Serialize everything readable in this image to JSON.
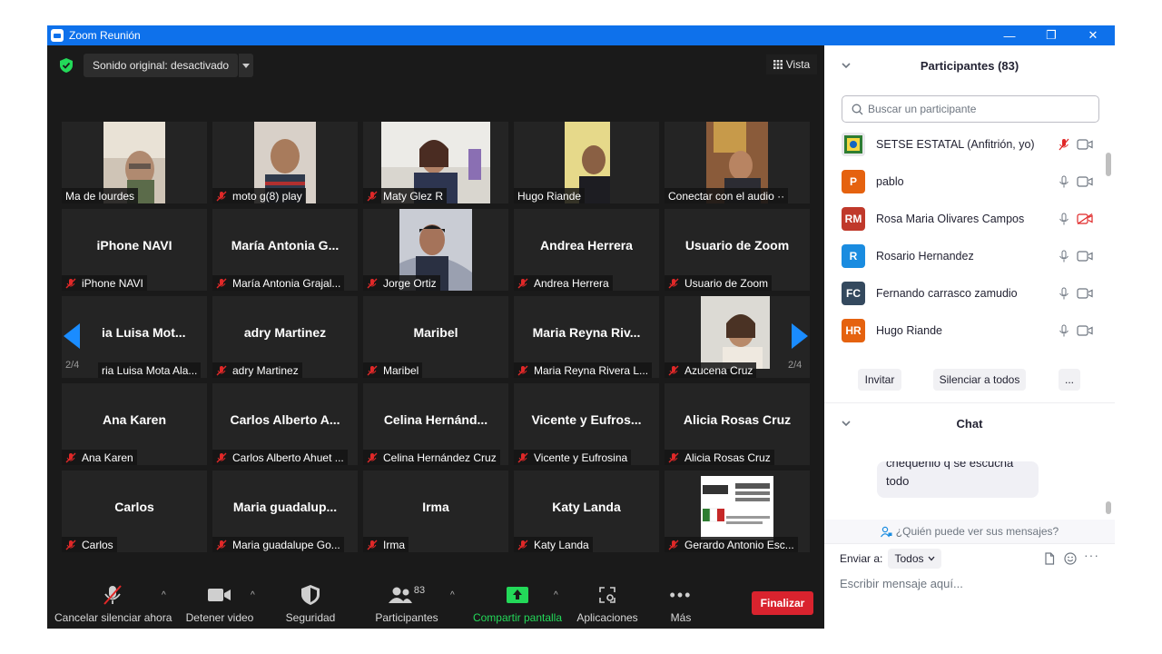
{
  "window": {
    "title": "Zoom Reunión"
  },
  "top_bar": {
    "audio_label": "Sonido original: desactivado",
    "view_label": "Vista"
  },
  "pagination": {
    "left": "2/4",
    "right": "2/4"
  },
  "tiles": [
    {
      "label": "Ma de lourdes",
      "big": "",
      "muted": false,
      "photo": true
    },
    {
      "label": "moto g(8) play",
      "big": "",
      "muted": true,
      "photo": true
    },
    {
      "label": "Maty Glez R",
      "big": "",
      "muted": true,
      "photo": true
    },
    {
      "label": "Hugo Riande",
      "big": "",
      "muted": false,
      "photo": true
    },
    {
      "label": "Conectar con el audio ··",
      "big": "",
      "muted": false,
      "photo": true
    },
    {
      "label": "iPhone NAVI",
      "big": "iPhone NAVI",
      "muted": true,
      "photo": false
    },
    {
      "label": "María Antonia Grajal...",
      "big": "María Antonia G...",
      "muted": true,
      "photo": false
    },
    {
      "label": "Jorge Ortiz",
      "big": "",
      "muted": true,
      "photo": true
    },
    {
      "label": "Andrea Herrera",
      "big": "Andrea Herrera",
      "muted": true,
      "photo": false
    },
    {
      "label": "Usuario de Zoom",
      "big": "Usuario de Zoom",
      "muted": true,
      "photo": false
    },
    {
      "label": "ria Luisa Mota Ala...",
      "big": "ia Luisa Mot...",
      "muted": false,
      "photo": false
    },
    {
      "label": "adry  Martinez",
      "big": "adry  Martinez",
      "muted": true,
      "photo": false
    },
    {
      "label": "Maribel",
      "big": "Maribel",
      "muted": true,
      "photo": false
    },
    {
      "label": "Maria Reyna Rivera L...",
      "big": "Maria Reyna Riv...",
      "muted": true,
      "photo": false
    },
    {
      "label": "Azucena Cruz",
      "big": "",
      "muted": true,
      "photo": true
    },
    {
      "label": "Ana Karen",
      "big": "Ana Karen",
      "muted": true,
      "photo": false
    },
    {
      "label": "Carlos Alberto Ahuet ...",
      "big": "Carlos Alberto A...",
      "muted": true,
      "photo": false
    },
    {
      "label": "Celina Hernández Cruz",
      "big": "Celina  Hernánd...",
      "muted": true,
      "photo": false
    },
    {
      "label": "Vicente y Eufrosina",
      "big": "Vicente y Eufros...",
      "muted": true,
      "photo": false
    },
    {
      "label": "Alicia Rosas Cruz",
      "big": "Alicia Rosas Cruz",
      "muted": true,
      "photo": false
    },
    {
      "label": "Carlos",
      "big": "Carlos",
      "muted": true,
      "photo": false
    },
    {
      "label": "Maria guadalupe Go...",
      "big": "Maria  guadalup...",
      "muted": true,
      "photo": false
    },
    {
      "label": "Irma",
      "big": "Irma",
      "muted": true,
      "photo": false
    },
    {
      "label": "Katy Landa",
      "big": "Katy Landa",
      "muted": true,
      "photo": false
    },
    {
      "label": "Gerardo Antonio Esc...",
      "big": "",
      "muted": true,
      "photo": true
    }
  ],
  "toolbar": {
    "unmute": "Cancelar silenciar ahora",
    "video": "Detener video",
    "security": "Seguridad",
    "participants": "Participantes",
    "participants_count": "83",
    "share": "Compartir pantalla",
    "apps": "Aplicaciones",
    "more": "Más",
    "end": "Finalizar"
  },
  "sidebar": {
    "participants_title": "Participantes (83)",
    "search_placeholder": "Buscar un participante",
    "participants": [
      {
        "initials": "",
        "name": "SETSE ESTATAL (Anfitrión, yo)",
        "color": "#e7e7ea",
        "mic": "muted",
        "cam": "on"
      },
      {
        "initials": "P",
        "name": "pablo",
        "color": "#e5620f",
        "mic": "on",
        "cam": "on"
      },
      {
        "initials": "RM",
        "name": "Rosa Maria Olivares Campos",
        "color": "#c0392b",
        "mic": "on",
        "cam": "off"
      },
      {
        "initials": "R",
        "name": "Rosario Hernandez",
        "color": "#1a8ce0",
        "mic": "on",
        "cam": "on"
      },
      {
        "initials": "FC",
        "name": "Fernando carrasco zamudio",
        "color": "#34495e",
        "mic": "on",
        "cam": "on"
      },
      {
        "initials": "HR",
        "name": "Hugo Riande",
        "color": "#e5620f",
        "mic": "on",
        "cam": "on"
      }
    ],
    "invite": "Invitar",
    "mute_all": "Silenciar a todos",
    "more": "...",
    "chat_title": "Chat",
    "chat_message": "chequenlo q se escucha todo",
    "who_can_see": "¿Quién puede ver sus mensajes?",
    "send_to_label": "Enviar a:",
    "send_to_value": "Todos",
    "input_placeholder": "Escribir mensaje aquí..."
  }
}
